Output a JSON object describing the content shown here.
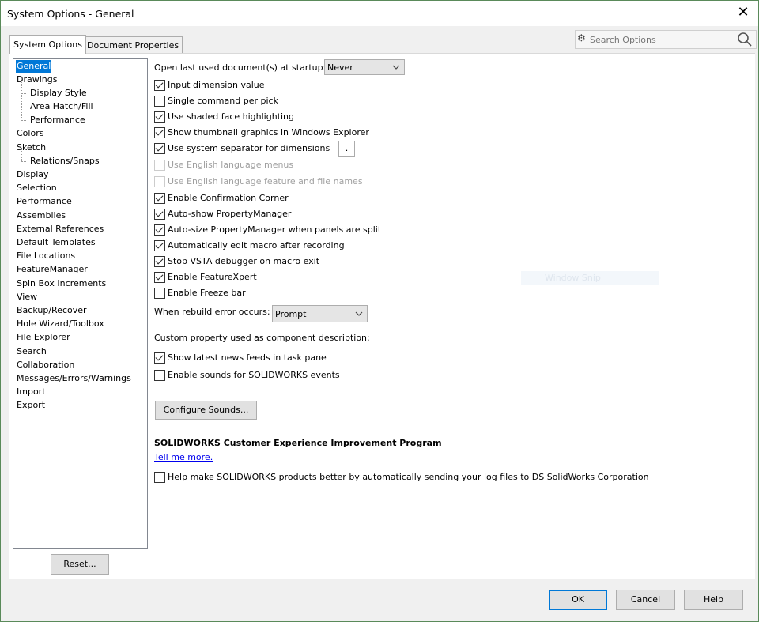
{
  "window": {
    "title": "System Options - General",
    "close_glyph": "✕"
  },
  "tabs": [
    {
      "label": "System Options",
      "active": true
    },
    {
      "label": "Document Properties",
      "active": false
    }
  ],
  "search": {
    "placeholder": "Search Options",
    "icon": "gear-icon",
    "action_icon": "magnifier-icon"
  },
  "tree": [
    {
      "label": "General",
      "selected": true
    },
    {
      "label": "Drawings"
    },
    {
      "label": "Display Style",
      "child": true
    },
    {
      "label": "Area Hatch/Fill",
      "child": true
    },
    {
      "label": "Performance",
      "child": true
    },
    {
      "label": "Colors"
    },
    {
      "label": "Sketch"
    },
    {
      "label": "Relations/Snaps",
      "child": true
    },
    {
      "label": "Display"
    },
    {
      "label": "Selection"
    },
    {
      "label": "Performance"
    },
    {
      "label": "Assemblies"
    },
    {
      "label": "External References"
    },
    {
      "label": "Default Templates"
    },
    {
      "label": "File Locations"
    },
    {
      "label": "FeatureManager"
    },
    {
      "label": "Spin Box Increments"
    },
    {
      "label": "View"
    },
    {
      "label": "Backup/Recover"
    },
    {
      "label": "Hole Wizard/Toolbox"
    },
    {
      "label": "File Explorer"
    },
    {
      "label": "Search"
    },
    {
      "label": "Collaboration"
    },
    {
      "label": "Messages/Errors/Warnings"
    },
    {
      "label": "Import"
    },
    {
      "label": "Export"
    }
  ],
  "reset_label": "Reset...",
  "general": {
    "open_last_label": "Open last used document(s) at startup:",
    "open_last_value": "Never",
    "checks": [
      {
        "label": "Input dimension value",
        "checked": true
      },
      {
        "label": "Single command per pick",
        "checked": false
      },
      {
        "label": "Use shaded face highlighting",
        "checked": true
      },
      {
        "label": "Show thumbnail graphics in Windows Explorer",
        "checked": true
      },
      {
        "label": "Use system separator for dimensions",
        "checked": true
      },
      {
        "label": "Use English language menus",
        "checked": false,
        "disabled": true
      },
      {
        "label": "Use English language feature and file names",
        "checked": false,
        "disabled": true
      },
      {
        "label": "Enable Confirmation Corner",
        "checked": true
      },
      {
        "label": "Auto-show PropertyManager",
        "checked": true
      },
      {
        "label": "Auto-size PropertyManager when panels are split",
        "checked": true
      },
      {
        "label": "Automatically edit macro after recording",
        "checked": true
      },
      {
        "label": "Stop VSTA debugger on macro exit",
        "checked": true
      },
      {
        "label": "Enable FeatureXpert",
        "checked": true
      },
      {
        "label": "Enable Freeze bar",
        "checked": false
      }
    ],
    "separator_value": ".",
    "rebuild_label": "When rebuild error occurs:",
    "rebuild_value": "Prompt",
    "custom_prop_label": "Custom property used as component description:",
    "checks2": [
      {
        "label": "Show latest news feeds in task pane",
        "checked": true
      },
      {
        "label": "Enable sounds for SOLIDWORKS events",
        "checked": false
      }
    ],
    "configure_sounds_label": "Configure Sounds...",
    "ceip_title": "SOLIDWORKS Customer Experience Improvement Program",
    "tell_me_more": "Tell me more.",
    "ceip_check": {
      "label": "Help make SOLIDWORKS products better by automatically sending your log files to DS SolidWorks Corporation",
      "checked": false
    }
  },
  "overlay_text": "Window Snip",
  "buttons": {
    "ok": "OK",
    "cancel": "Cancel",
    "help": "Help"
  }
}
